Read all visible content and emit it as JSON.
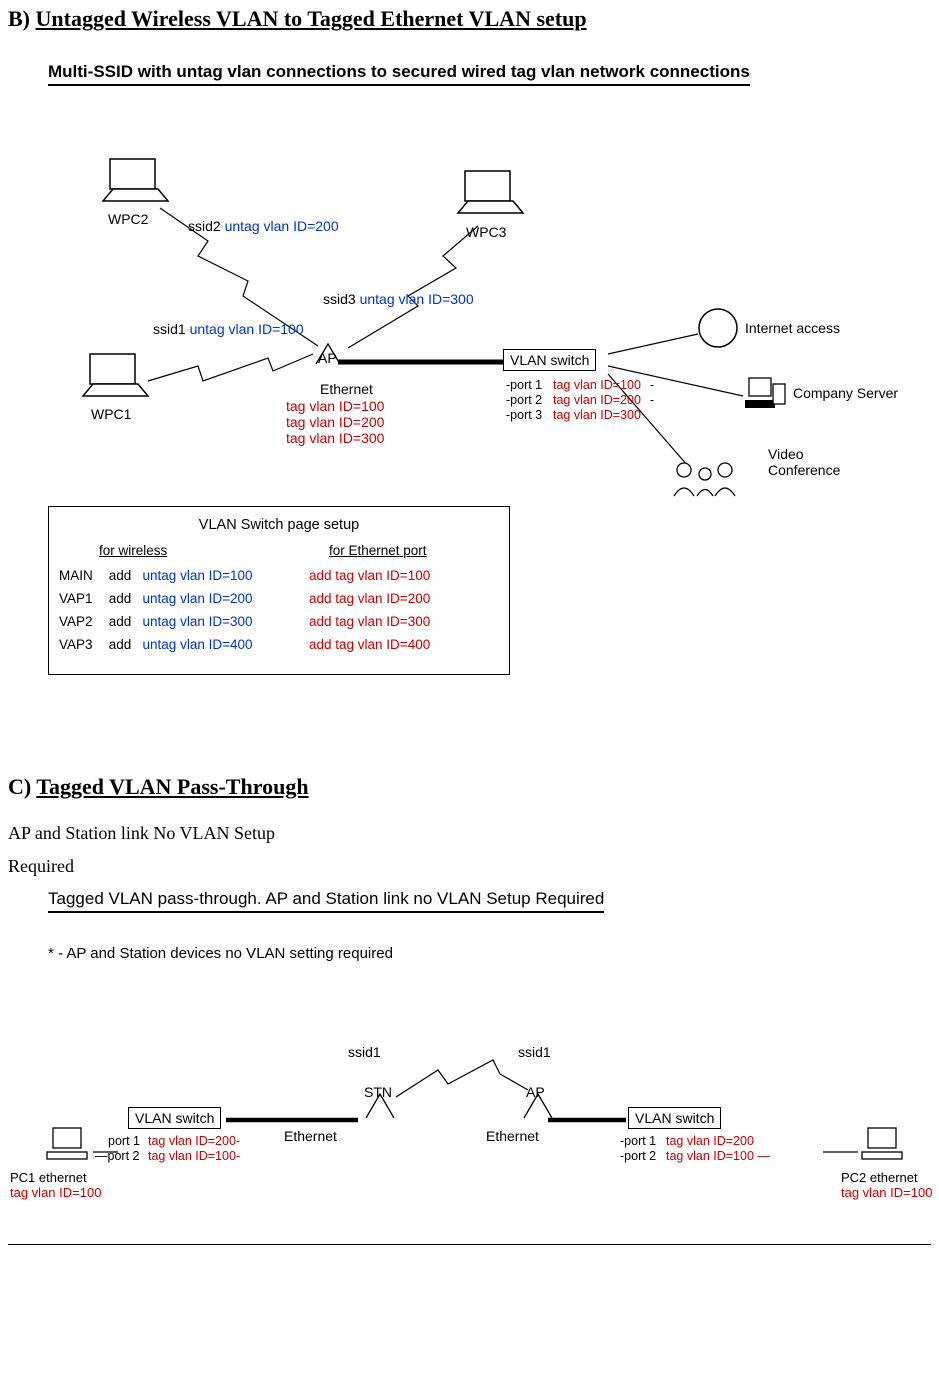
{
  "sectionB": {
    "prefix": "B) ",
    "title": "Untagged Wireless VLAN to Tagged Ethernet VLAN setup"
  },
  "figB": {
    "title": "Multi-SSID with untag vlan connections to secured wired tag vlan network connections",
    "wpc1": "WPC1",
    "wpc2": "WPC2",
    "wpc3": "WPC3",
    "ssid1": "ssid1",
    "ssid2": "ssid2",
    "ssid3": "ssid3",
    "untag100": "untag vlan ID=100",
    "untag200": "untag vlan ID=200",
    "untag300": "untag vlan ID=300",
    "ap": "AP",
    "ethernet": "Ethernet",
    "ethtag100": "tag vlan ID=100",
    "ethtag200": "tag vlan ID=200",
    "ethtag300": "tag vlan ID=300",
    "vlanswitch": "VLAN switch",
    "port1": "port 1",
    "port2": "port 2",
    "port3": "port 3",
    "p1tag": "tag vlan ID=100",
    "p2tag": "tag vlan ID=200",
    "p3tag": "tag vlan ID=300",
    "internet": "Internet access",
    "company": "Company Server",
    "video1": "Video",
    "video2": "Conference",
    "setup": {
      "title": "VLAN Switch page setup",
      "headWireless": "for wireless",
      "headEth": "for Ethernet port",
      "rows": [
        {
          "vap": "MAIN",
          "act": "add",
          "wl": "untag vlan ID=100",
          "eth": "add tag vlan ID=100"
        },
        {
          "vap": "VAP1",
          "act": "add",
          "wl": "untag vlan ID=200",
          "eth": "add tag vlan ID=200"
        },
        {
          "vap": "VAP2",
          "act": "add",
          "wl": "untag vlan ID=300",
          "eth": "add tag vlan ID=300"
        },
        {
          "vap": "VAP3",
          "act": "add",
          "wl": "untag vlan ID=400",
          "eth": "add tag vlan ID=400"
        }
      ]
    }
  },
  "sectionC": {
    "prefix": "C) ",
    "title": "Tagged VLAN Pass-Through",
    "body1": "AP and Station link No VLAN Setup",
    "body2": "Required"
  },
  "figC": {
    "title_main": "Tagged VLAN pass-through. AP and Station link no VLAN Setup ",
    "title_req": "Required",
    "note": "* -  AP and Station devices no VLAN setting required",
    "ssid1_a": "ssid1",
    "ssid1_b": "ssid1",
    "stn": "STN",
    "ap": "AP",
    "ethernet": "Ethernet",
    "vlanswitch": "VLAN switch",
    "portL1": "port 1",
    "portL2": "port 2",
    "portR1": "port 1",
    "portR2": "port 2",
    "tagL1": "tag vlan ID=200",
    "tagL2": "tag vlan ID=100",
    "tagR1": "tag vlan ID=200",
    "tagR2": "tag vlan ID=100",
    "pc1a": "PC1 ethernet",
    "pc1b": "tag vlan ID=100",
    "pc2a": "PC2 ethernet",
    "pc2b": "tag vlan ID=100"
  }
}
